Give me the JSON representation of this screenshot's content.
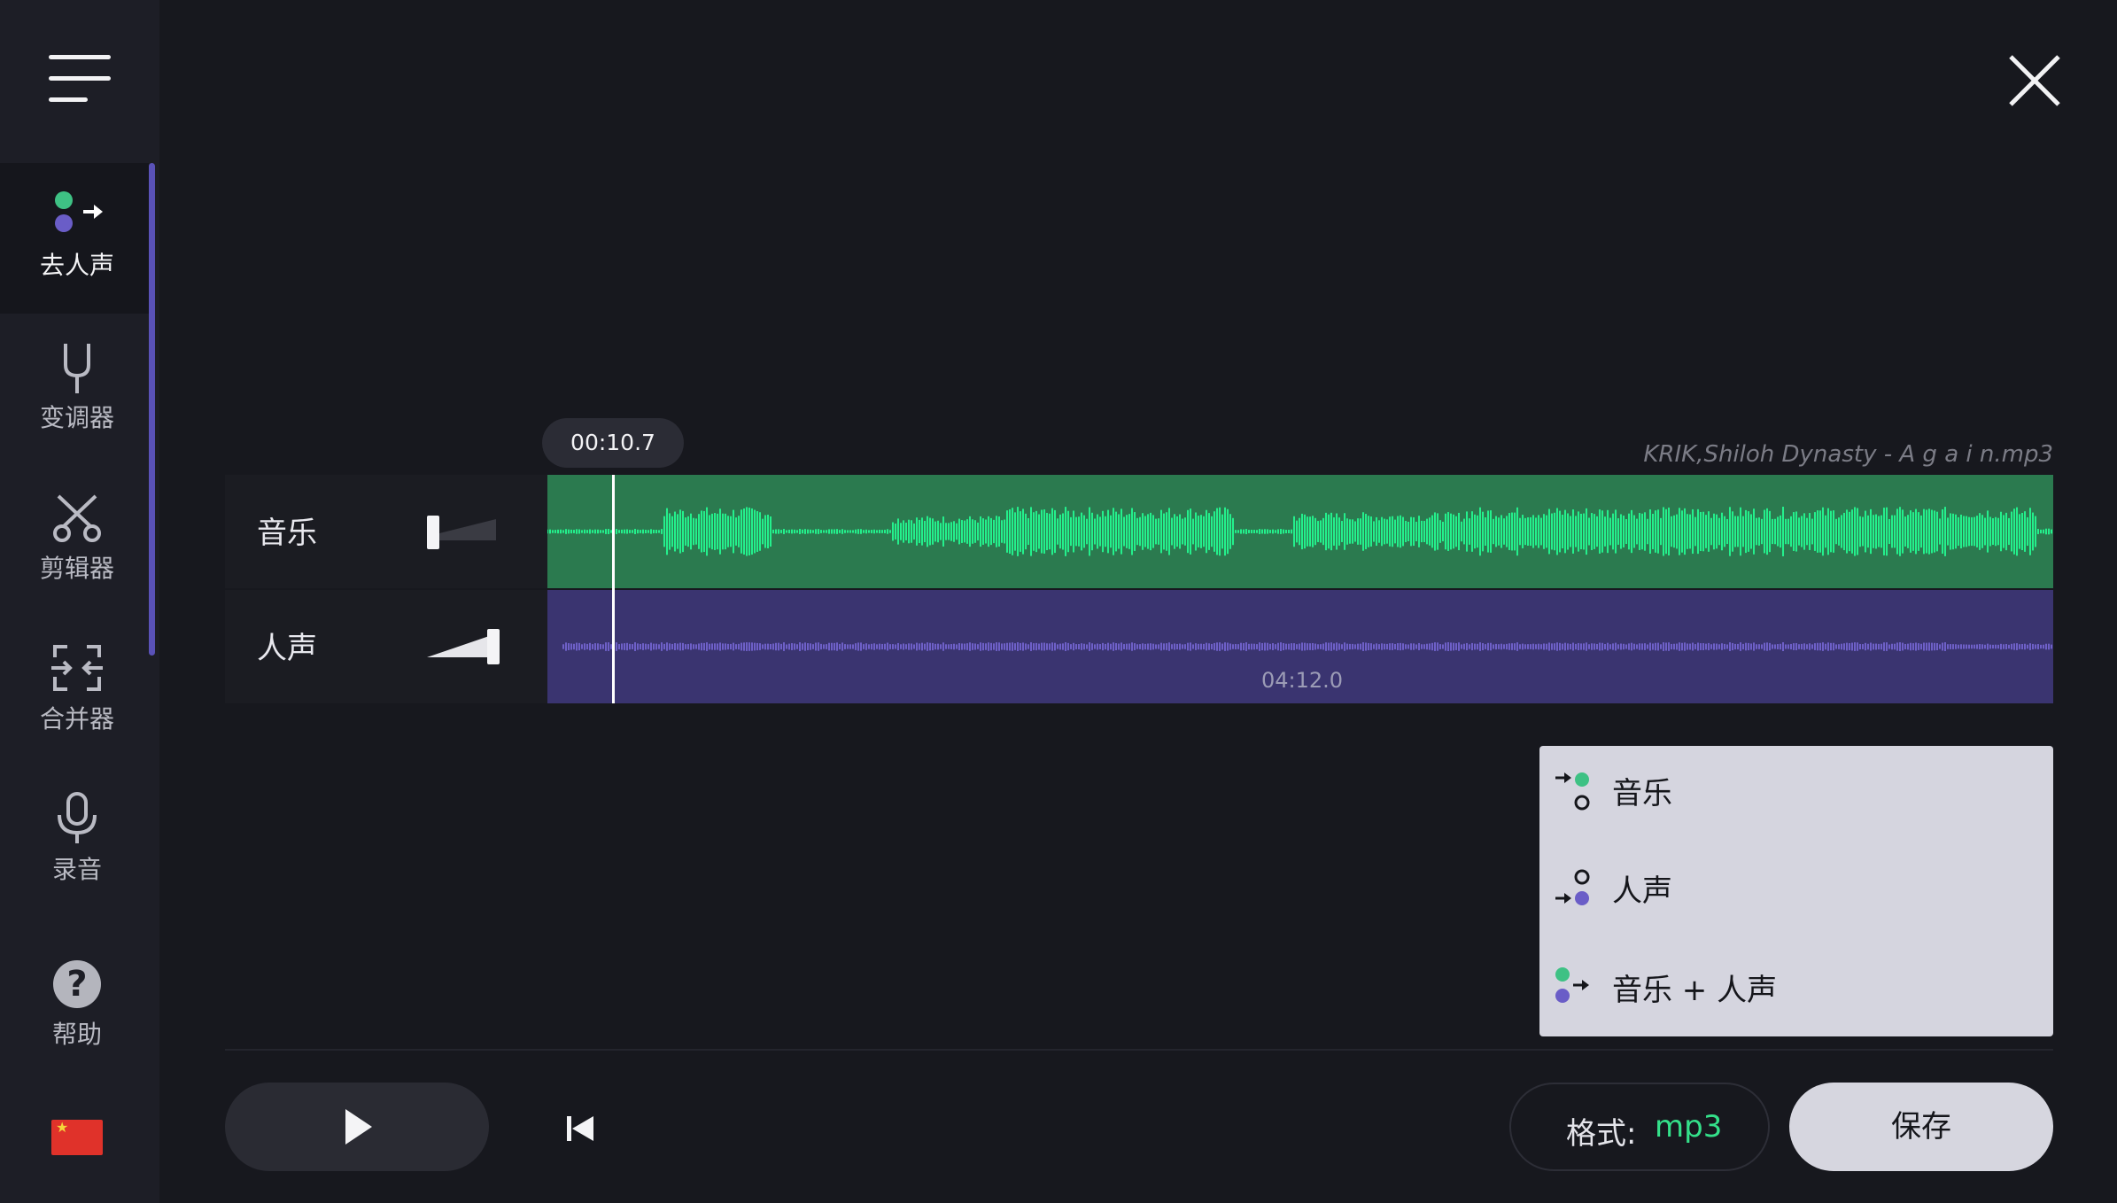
{
  "sidebar": {
    "items": [
      {
        "label": "去人声",
        "icon": "vocal-remover-icon",
        "active": true
      },
      {
        "label": "变调器",
        "icon": "tuning-fork-icon",
        "active": false
      },
      {
        "label": "剪辑器",
        "icon": "scissors-icon",
        "active": false
      },
      {
        "label": "合并器",
        "icon": "merge-icon",
        "active": false
      },
      {
        "label": "录音",
        "icon": "microphone-icon",
        "active": false
      }
    ],
    "help": {
      "label": "帮助",
      "icon": "help-icon"
    },
    "language_icon": "china-flag-icon"
  },
  "player": {
    "current_time": "00:10.7",
    "total_time": "04:12.0",
    "filename": "KRIK,Shiloh Dynasty - A g a i n.mp3",
    "playhead_fraction": 0.042
  },
  "tracks": [
    {
      "name": "音乐",
      "volume": 0.0,
      "color": "#2b7a4f",
      "wave_color": "#24f08c"
    },
    {
      "name": "人声",
      "volume": 1.0,
      "color": "#3a3470",
      "wave_color": "#6e60c8"
    }
  ],
  "export_menu": {
    "items": [
      {
        "label": "音乐"
      },
      {
        "label": "人声"
      },
      {
        "label": "音乐 + 人声"
      }
    ]
  },
  "footer": {
    "format_label": "格式:",
    "format_value": "mp3",
    "save_label": "保存"
  },
  "colors": {
    "accent_green": "#3ec184",
    "accent_purple": "#6a5dc7",
    "background": "#17181e"
  }
}
